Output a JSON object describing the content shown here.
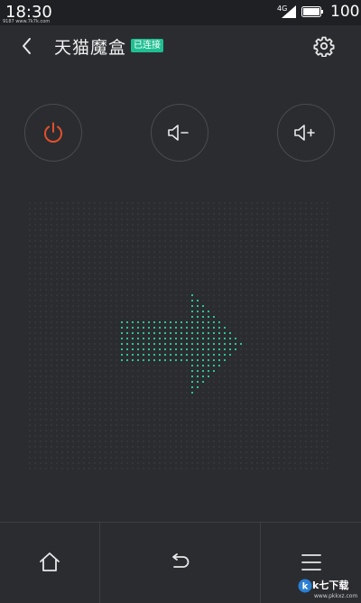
{
  "status_bar": {
    "time": "18:30",
    "tiny_text": "9187 www.7k7k.com",
    "network_label": "4G",
    "battery_label": "100"
  },
  "header": {
    "title": "天猫魔盒",
    "connection_badge": "已连接"
  },
  "controls": {
    "power_icon": "power-icon",
    "volume_down_icon": "volume-down-icon",
    "volume_up_icon": "volume-up-icon"
  },
  "touchpad": {
    "gesture_direction": "right",
    "arrow_color": "#2dd4a0",
    "dot_color": "#45464b"
  },
  "bottom_nav": {
    "home_icon": "home-icon",
    "back_icon": "undo-back-icon",
    "menu_icon": "menu-icon"
  },
  "colors": {
    "background": "#2b2c30",
    "accent": "#1fbf92",
    "power": "#e2502c"
  },
  "watermark": {
    "name": "k七下载",
    "url": "www.pkkxz.com"
  }
}
